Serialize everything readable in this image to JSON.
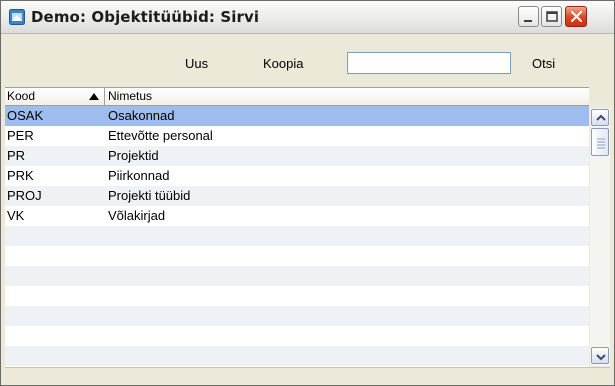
{
  "window": {
    "title": "Demo: Objektitüübid: Sirvi",
    "icon": "app-window-icon",
    "controls": [
      "minimize-icon",
      "maximize-icon",
      "close-icon"
    ]
  },
  "toolbar": {
    "new_label": "Uus",
    "copy_label": "Koopia",
    "search_label": "Otsi",
    "search_value": ""
  },
  "table": {
    "columns": [
      {
        "label": "Kood",
        "sort": "ascending",
        "sort_icon": "sort-ascending-icon"
      },
      {
        "label": "Nimetus"
      }
    ],
    "rows": [
      {
        "code": "OSAK",
        "name": "Osakonnad",
        "selected": true
      },
      {
        "code": "PER",
        "name": "Ettevõtte personal"
      },
      {
        "code": "PR",
        "name": "Projektid"
      },
      {
        "code": "PRK",
        "name": "Piirkonnad"
      },
      {
        "code": "PROJ",
        "name": "Projekti tüübid"
      },
      {
        "code": "VK",
        "name": "Võlakirjad"
      },
      {
        "code": "",
        "name": ""
      },
      {
        "code": "",
        "name": ""
      },
      {
        "code": "",
        "name": ""
      },
      {
        "code": "",
        "name": ""
      },
      {
        "code": "",
        "name": ""
      },
      {
        "code": "",
        "name": ""
      },
      {
        "code": "",
        "name": ""
      }
    ]
  },
  "colors": {
    "selected_row": "#9ebded",
    "alt_row": "#eff2f5",
    "window_bg": "#ece9d8",
    "close_button": "#d9441f"
  }
}
